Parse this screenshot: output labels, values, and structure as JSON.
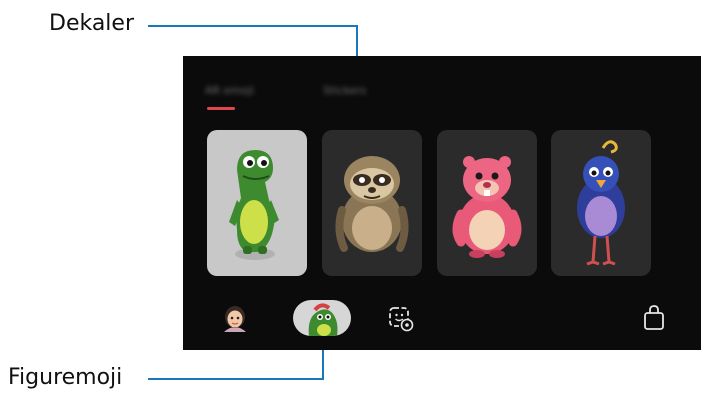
{
  "callouts": {
    "top_label": "Dekaler",
    "bottom_label": "Figuremoji"
  },
  "tabs": [
    {
      "label": "AR emoji"
    },
    {
      "label": "Stickers"
    }
  ],
  "characters": [
    {
      "name": "dinosaur",
      "selected": true
    },
    {
      "name": "sloth",
      "selected": false
    },
    {
      "name": "pink-bear",
      "selected": false
    },
    {
      "name": "blue-bird",
      "selected": false
    }
  ],
  "bottom_bar": {
    "items": [
      "avatar-icon",
      "figuremoji-icon",
      "sticker-settings-icon",
      "shopping-bag-icon"
    ],
    "selected": "figuremoji-icon"
  },
  "colors": {
    "accent": "#e0474c",
    "callout_line": "#1a78b8",
    "screen_background": "#0b0b0b",
    "selected_card": "#c8c8c8",
    "card": "#2b2b2b"
  }
}
